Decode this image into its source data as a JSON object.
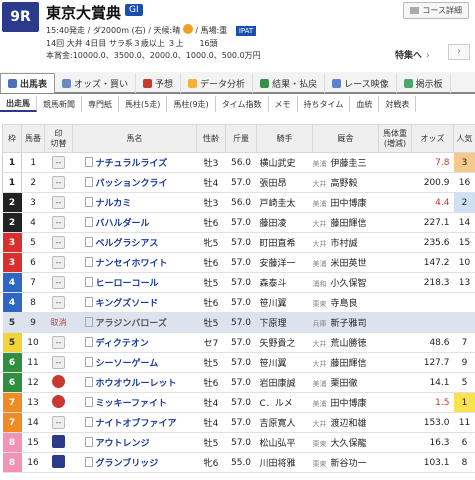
{
  "race": {
    "number": "9R",
    "title": "東京大賞典",
    "grade": "GI",
    "line1": "15:40発走 / ダ2000m (右) / 天候:晴",
    "condition": "/ 馬場:重",
    "ipat": "IPAT",
    "line2": "14回 大井 4日目 サラ系３歳以上 ３上　　16頭",
    "line3": "本賞金:10000.0、3500.0、2000.0、1000.0、500.0万円",
    "course_button": "コース詳細",
    "special": "特集へ",
    "special_arrow": "›",
    "next": "›"
  },
  "tabs": [
    {
      "label": "出馬表",
      "color": "#4b6fb8",
      "active": true
    },
    {
      "label": "オッズ・買い",
      "color": "#6d87bf",
      "active": false
    },
    {
      "label": "予想",
      "color": "#c8392f",
      "active": false
    },
    {
      "label": "データ分析",
      "color": "#f3b23c",
      "active": false
    },
    {
      "label": "結果・払戻",
      "color": "#3a8f4a",
      "active": false
    },
    {
      "label": "レース映像",
      "color": "#5a84c7",
      "active": false
    },
    {
      "label": "掲示板",
      "color": "#4aa86a",
      "active": false
    }
  ],
  "subtabs": [
    "出走馬",
    "競馬新聞",
    "専門紙",
    "馬柱(5走)",
    "馬柱(9走)",
    "タイム指数",
    "メモ",
    "持ちタイム",
    "血統",
    "対戦表"
  ],
  "columns": {
    "waku": "枠",
    "uma": "馬番",
    "mark": "印",
    "mark2": "切替",
    "name": "馬名",
    "sa": "性齢",
    "kin": "斤量",
    "jockey": "騎手",
    "trainer": "厩舎",
    "weight": "馬体重",
    "weight2": "(増減)",
    "odds": "オッズ",
    "pop": "人気"
  },
  "horses": [
    {
      "waku": "1",
      "wk": "wk1",
      "uma": "1",
      "mark": "--",
      "name": "ナチュラルライズ",
      "sa": "牡3",
      "kin": "56.0",
      "jockey": "横山武史",
      "region": "美浦",
      "trainer": "伊藤圭三",
      "odds": "7.8",
      "hot": true,
      "pop": "3",
      "popc": "p3"
    },
    {
      "waku": "1",
      "wk": "wk1",
      "uma": "2",
      "mark": "--",
      "name": "パッションクライ",
      "sa": "牡4",
      "kin": "57.0",
      "jockey": "張田昂",
      "region": "大井",
      "trainer": "高野毅",
      "odds": "200.9",
      "hot": false,
      "pop": "16",
      "popc": ""
    },
    {
      "waku": "2",
      "wk": "wk2",
      "uma": "3",
      "mark": "--",
      "name": "ナルカミ",
      "sa": "牡3",
      "kin": "56.0",
      "jockey": "戸崎圭太",
      "region": "美浦",
      "trainer": "田中博康",
      "odds": "4.4",
      "hot": true,
      "pop": "2",
      "popc": "p2"
    },
    {
      "waku": "2",
      "wk": "wk2",
      "uma": "4",
      "mark": "--",
      "name": "バハルダール",
      "sa": "牡6",
      "kin": "57.0",
      "jockey": "藤田凌",
      "region": "大井",
      "trainer": "藤田輝信",
      "odds": "227.1",
      "hot": false,
      "pop": "14",
      "popc": ""
    },
    {
      "waku": "3",
      "wk": "wk3",
      "uma": "5",
      "mark": "--",
      "name": "ベルグラシアス",
      "sa": "牝5",
      "kin": "57.0",
      "jockey": "町田直希",
      "region": "大井",
      "trainer": "市村誠",
      "odds": "235.6",
      "hot": false,
      "pop": "15",
      "popc": ""
    },
    {
      "waku": "3",
      "wk": "wk3",
      "uma": "6",
      "mark": "--",
      "name": "ナンセイホワイト",
      "sa": "牡6",
      "kin": "57.0",
      "jockey": "安藤洋一",
      "region": "美浦",
      "trainer": "米田英世",
      "odds": "147.2",
      "hot": false,
      "pop": "10",
      "popc": ""
    },
    {
      "waku": "4",
      "wk": "wk4",
      "uma": "7",
      "mark": "--",
      "name": "ヒーローコール",
      "sa": "牡5",
      "kin": "57.0",
      "jockey": "森泰斗",
      "region": "浦和",
      "trainer": "小久保智",
      "odds": "218.3",
      "hot": false,
      "pop": "13",
      "popc": ""
    },
    {
      "waku": "4",
      "wk": "wk4",
      "uma": "8",
      "mark": "--",
      "name": "キングズソード",
      "sa": "牡6",
      "kin": "57.0",
      "jockey": "笹川翼",
      "region": "栗東",
      "trainer": "寺島良",
      "odds": "",
      "hot": false,
      "pop": "",
      "popc": ""
    },
    {
      "waku": "5",
      "wk": "wk5",
      "uma": "9",
      "mark": "取消",
      "scratch": true,
      "name": "アラジンバローズ",
      "sa": "牡5",
      "kin": "57.0",
      "jockey": "下原理",
      "region": "兵庫",
      "trainer": "新子雅司",
      "odds": "",
      "hot": false,
      "pop": "",
      "popc": "",
      "dim": true
    },
    {
      "waku": "5",
      "wk": "wk5",
      "uma": "10",
      "mark": "--",
      "name": "ディクテオン",
      "sa": "セ7",
      "kin": "57.0",
      "jockey": "矢野貴之",
      "region": "大井",
      "trainer": "荒山勝徳",
      "odds": "48.6",
      "hot": false,
      "pop": "7",
      "popc": ""
    },
    {
      "waku": "6",
      "wk": "wk6",
      "uma": "11",
      "mark": "--",
      "name": "シーソーゲーム",
      "sa": "牡5",
      "kin": "57.0",
      "jockey": "笹川翼",
      "region": "大井",
      "trainer": "藤田輝信",
      "odds": "127.7",
      "hot": false,
      "pop": "9",
      "popc": ""
    },
    {
      "waku": "6",
      "wk": "wk6",
      "uma": "12",
      "mark": "circ",
      "name": "ホウオウルーレット",
      "sa": "牡6",
      "kin": "57.0",
      "jockey": "岩田康誠",
      "region": "美浦",
      "trainer": "栗田徹",
      "odds": "14.1",
      "hot": false,
      "pop": "5",
      "popc": ""
    },
    {
      "waku": "7",
      "wk": "wk7",
      "uma": "13",
      "mark": "circ",
      "name": "ミッキーファイト",
      "sa": "牡4",
      "kin": "57.0",
      "jockey": "C．ルメ",
      "region": "美浦",
      "trainer": "田中博康",
      "odds": "1.5",
      "hot": true,
      "pop": "1",
      "popc": "p1"
    },
    {
      "waku": "7",
      "wk": "wk7",
      "uma": "14",
      "mark": "--",
      "name": "ナイトオブファイア",
      "sa": "牡4",
      "kin": "57.0",
      "jockey": "吉原寛人",
      "region": "大井",
      "trainer": "渡辺和雄",
      "odds": "153.0",
      "hot": false,
      "pop": "11",
      "popc": ""
    },
    {
      "waku": "8",
      "wk": "wk8",
      "uma": "15",
      "mark": "tri",
      "name": "アウトレンジ",
      "sa": "牡5",
      "kin": "57.0",
      "jockey": "松山弘平",
      "region": "栗東",
      "trainer": "大久保龍",
      "odds": "16.3",
      "hot": false,
      "pop": "6",
      "popc": ""
    },
    {
      "waku": "8",
      "wk": "wk8",
      "uma": "16",
      "mark": "tri",
      "name": "グランブリッジ",
      "sa": "牝6",
      "kin": "55.0",
      "jockey": "川田将雅",
      "region": "栗東",
      "trainer": "新谷功一",
      "odds": "103.1",
      "hot": false,
      "pop": "8",
      "popc": ""
    }
  ]
}
